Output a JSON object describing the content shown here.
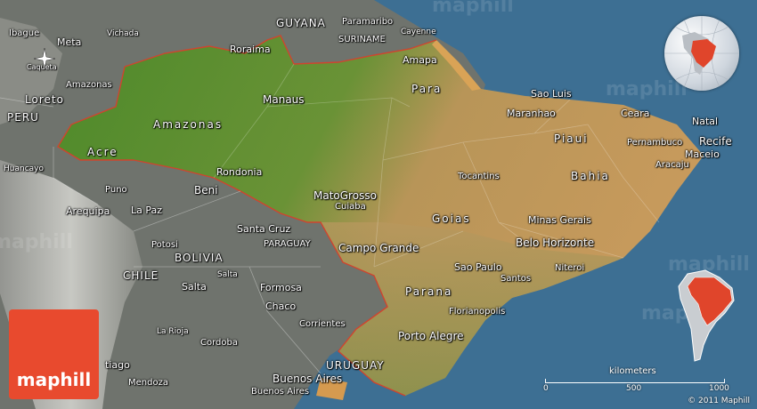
{
  "map": {
    "countries": [
      {
        "id": "guyana",
        "text": "GUYANA"
      },
      {
        "id": "suriname",
        "text": "SURINAME"
      },
      {
        "id": "peru",
        "text": "PERU"
      },
      {
        "id": "bolivia",
        "text": "BOLIVIA"
      },
      {
        "id": "paraguay",
        "text": "PARAGUAY"
      },
      {
        "id": "chile",
        "text": "CHILE"
      },
      {
        "id": "uruguay",
        "text": "URUGUAY"
      }
    ],
    "states": [
      {
        "id": "roraima",
        "text": "Roraima"
      },
      {
        "id": "amapa",
        "text": "Amapa"
      },
      {
        "id": "amazonas",
        "text": "Amazonas"
      },
      {
        "id": "para",
        "text": "Para"
      },
      {
        "id": "maranhao",
        "text": "Maranhao"
      },
      {
        "id": "ceara",
        "text": "Ceara"
      },
      {
        "id": "piaui",
        "text": "Piaui"
      },
      {
        "id": "acre",
        "text": "Acre"
      },
      {
        "id": "rondonia",
        "text": "Rondonia"
      },
      {
        "id": "mato-grosso",
        "text": "MatoGrosso"
      },
      {
        "id": "tocantins",
        "text": "Tocantins"
      },
      {
        "id": "bahia",
        "text": "Bahia"
      },
      {
        "id": "goias",
        "text": "Goias"
      },
      {
        "id": "minas-gerais",
        "text": "Minas Gerais"
      },
      {
        "id": "sao-paulo",
        "text": "Sao Paulo"
      },
      {
        "id": "parana",
        "text": "Parana"
      },
      {
        "id": "pernambuco",
        "text": "Pernambuco"
      },
      {
        "id": "beni",
        "text": "Beni"
      }
    ],
    "cities": [
      {
        "id": "paramaribo",
        "text": "Paramaribo"
      },
      {
        "id": "cayenne",
        "text": "Cayenne"
      },
      {
        "id": "manaus",
        "text": "Manaus"
      },
      {
        "id": "sao-luis",
        "text": "Sao Luis"
      },
      {
        "id": "natal",
        "text": "Natal"
      },
      {
        "id": "recife",
        "text": "Recife"
      },
      {
        "id": "maceio",
        "text": "Maceio"
      },
      {
        "id": "aracaju",
        "text": "Aracaju"
      },
      {
        "id": "cuiaba",
        "text": "Cuiaba"
      },
      {
        "id": "campo-grande",
        "text": "Campo Grande"
      },
      {
        "id": "belo-horizonte",
        "text": "Belo Horizonte"
      },
      {
        "id": "niteroi",
        "text": "Niteroi"
      },
      {
        "id": "santos",
        "text": "Santos"
      },
      {
        "id": "florianopolis",
        "text": "Florianopolis"
      },
      {
        "id": "porto-alegre",
        "text": "Porto Alegre"
      },
      {
        "id": "santa-cruz",
        "text": "Santa Cruz"
      },
      {
        "id": "la-paz",
        "text": "La Paz"
      },
      {
        "id": "arequipa",
        "text": "Arequipa"
      },
      {
        "id": "puno",
        "text": "Puno"
      },
      {
        "id": "potosi",
        "text": "Potosi"
      },
      {
        "id": "salta",
        "text": "Salta"
      },
      {
        "id": "formosa",
        "text": "Formosa"
      },
      {
        "id": "chaco",
        "text": "Chaco"
      },
      {
        "id": "corrientes",
        "text": "Corrientes"
      },
      {
        "id": "cordoba",
        "text": "Cordoba"
      },
      {
        "id": "mendoza",
        "text": "Mendoza"
      },
      {
        "id": "buenos-aires",
        "text": "Buenos Aires"
      },
      {
        "id": "buenos-aires-2",
        "text": "Buenos Aires"
      },
      {
        "id": "santiago",
        "text": "tiago"
      },
      {
        "id": "ibague",
        "text": "Ibague"
      },
      {
        "id": "meta",
        "text": "Meta"
      },
      {
        "id": "vichada",
        "text": "Vichada"
      },
      {
        "id": "amazonas-co",
        "text": "Amazonas"
      },
      {
        "id": "loreto",
        "text": "Loreto"
      },
      {
        "id": "huancayo",
        "text": "Huancayo"
      },
      {
        "id": "caqueta",
        "text": "Caqueta"
      },
      {
        "id": "la-rioja",
        "text": "La Rioja"
      },
      {
        "id": "salta-2",
        "text": "Salta"
      }
    ]
  },
  "branding": {
    "logo_text": "maphill",
    "watermark": "maphill"
  },
  "scale": {
    "title": "kilometers",
    "ticks": [
      "0",
      "500",
      "1000"
    ]
  },
  "copyright": "© 2011 Maphill",
  "colors": {
    "ocean": "#3d6f93",
    "amazon_green": "#4f8a2c",
    "cerrado_tan": "#c49a60",
    "neighbor_gray": "#7a7d77",
    "border_red": "#d0442e",
    "logo_red": "#e84a2e"
  }
}
